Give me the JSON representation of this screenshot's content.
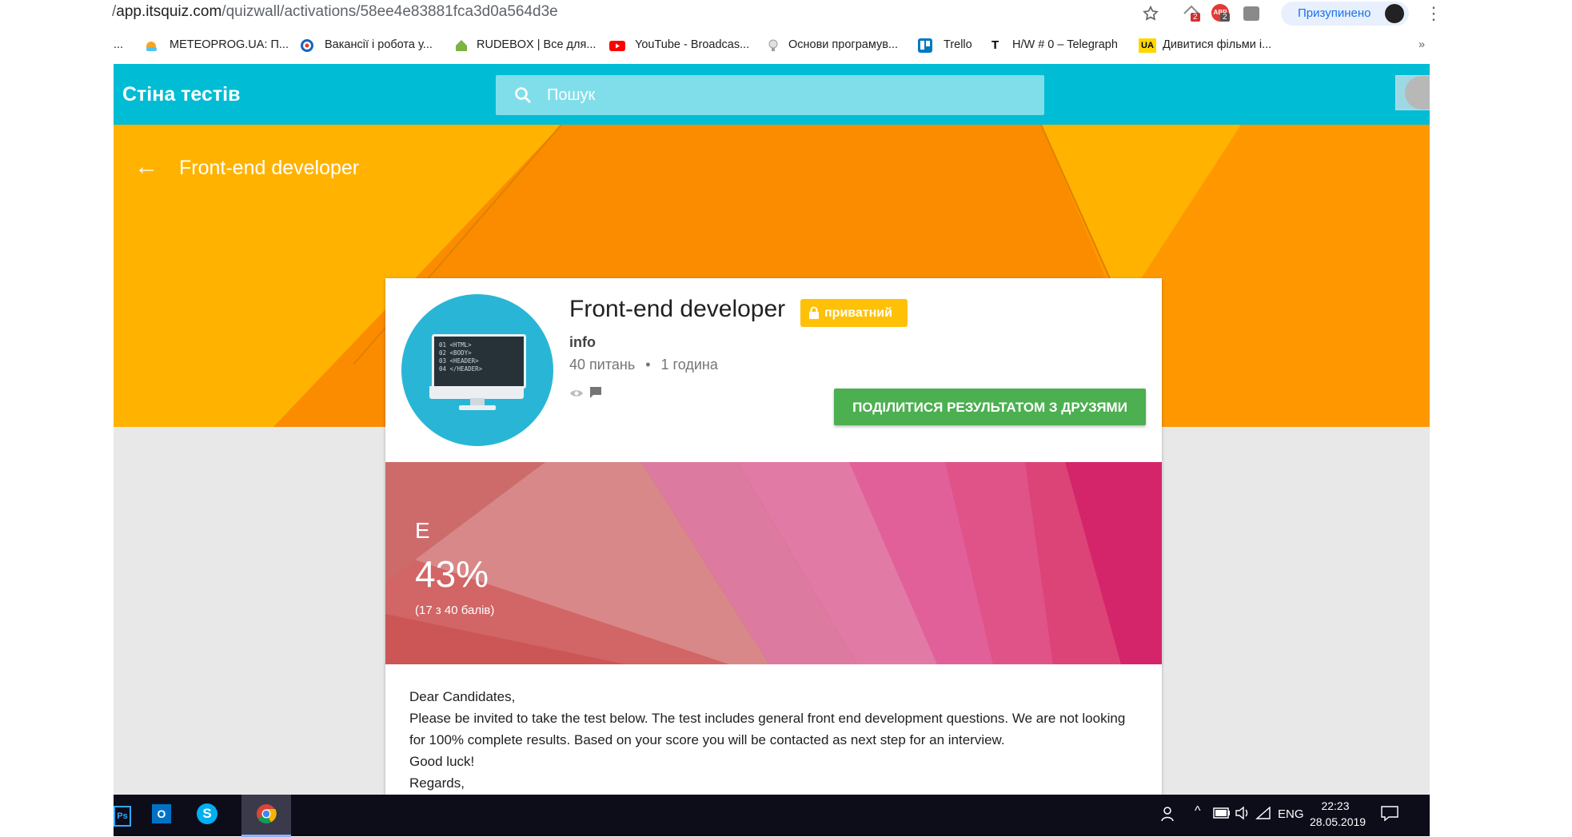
{
  "browser": {
    "url_prefix": "/",
    "url_host": "app.itsquiz.com",
    "url_path": "/quizwall/activations/58ee4e83881fca3d0a564d3e",
    "profile_label": "Призупинено",
    "ext_badge_1": "2",
    "ext_badge_2": "2",
    "bookmarks": [
      {
        "label": "...",
        "icon": "ellipsis-icon"
      },
      {
        "label": "METEOPROG.UA: П...",
        "icon": "weather-icon"
      },
      {
        "label": "Вакансії і робота у...",
        "icon": "target-icon"
      },
      {
        "label": "RUDEBOX | Все для...",
        "icon": "house-icon"
      },
      {
        "label": "YouTube - Broadcas...",
        "icon": "youtube-icon"
      },
      {
        "label": "Основи програмув...",
        "icon": "bulb-icon"
      },
      {
        "label": "Trello",
        "icon": "trello-icon"
      },
      {
        "label": "H/W # 0 – Telegraph",
        "icon": "telegraph-icon"
      },
      {
        "label": "Дивитися фільми і...",
        "icon": "ua-icon"
      }
    ],
    "overflow": "»"
  },
  "app": {
    "title": "Стіна тестів",
    "search_placeholder": "Пошук",
    "page_title": "Front-end developer"
  },
  "quiz": {
    "title": "Front-end developer",
    "badge": "приватний",
    "owner": "info",
    "questions": "40 питань",
    "separator": "•",
    "duration": "1 година",
    "logo_code": [
      "01 <HTML>",
      "02 <BODY>",
      "03 <HEADER>",
      "04 </HEADER>"
    ],
    "share_button": "ПОДІЛИТИСЯ РЕЗУЛЬТАТОМ З ДРУЗЯМИ"
  },
  "result": {
    "grade": "E",
    "percent": "43%",
    "score": "(17 з 40 балів)"
  },
  "description": [
    "Dear Candidates,",
    "Please be invited to take the test below.  The test includes general front end development questions. We are not looking for 100% complete results. Based on your score you will be contacted as next step for an interview.",
    "Good luck!",
    "Regards,"
  ],
  "taskbar": {
    "apps": [
      "Ps",
      "O",
      "S",
      "Chrome"
    ],
    "language": "ENG",
    "time": "22:23",
    "date": "28.05.2019"
  },
  "colors": {
    "app_bar": "#00bcd4",
    "hero": "#ff9800",
    "badge": "#ffc107",
    "share_button": "#4caf50",
    "result_banner": "#d8457a"
  }
}
